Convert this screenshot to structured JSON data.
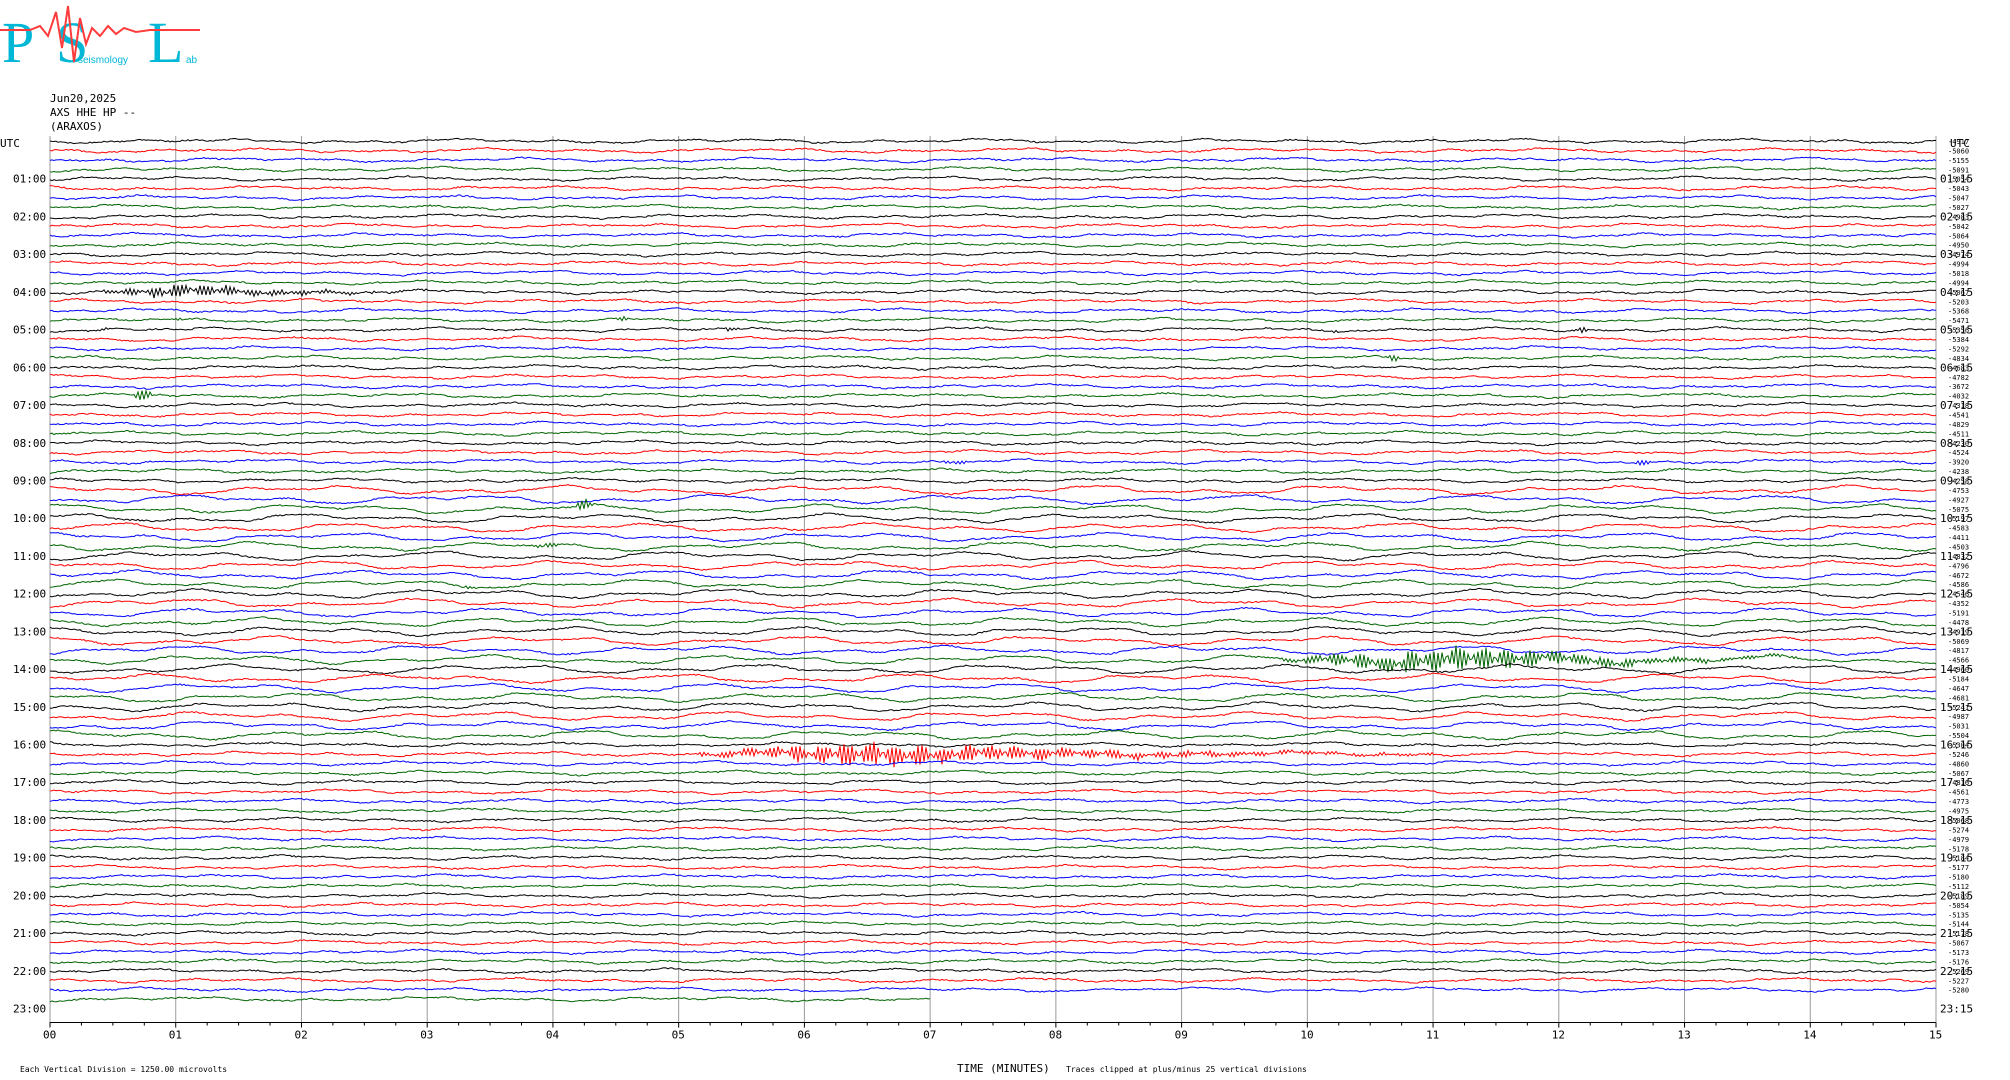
{
  "logo": {
    "letters": [
      "P",
      "S",
      "L"
    ],
    "subtext_1": "seismology",
    "subtext_2": "ab",
    "colors": {
      "letters": "#00b7d6",
      "wave": "#ff3b3b"
    }
  },
  "header": {
    "date": "Jun20,2025",
    "channel": "AXS HHE HP --",
    "station": "(ARAXOS)"
  },
  "chart_data": {
    "type": "line",
    "title": "",
    "xlabel": "TIME (MINUTES)",
    "ylabel_left": "UTC",
    "ylabel_right": "UTC",
    "xlim": [
      0,
      15
    ],
    "x_ticks": [
      "00",
      "01",
      "02",
      "03",
      "04",
      "05",
      "06",
      "07",
      "08",
      "09",
      "10",
      "11",
      "12",
      "13",
      "14",
      "15"
    ],
    "left_hour_labels": [
      "01:00",
      "02:00",
      "03:00",
      "04:00",
      "05:00",
      "06:00",
      "07:00",
      "08:00",
      "09:00",
      "10:00",
      "11:00",
      "12:00",
      "13:00",
      "14:00",
      "15:00",
      "16:00",
      "17:00",
      "18:00",
      "19:00",
      "20:00",
      "21:00",
      "22:00",
      "23:00"
    ],
    "right_hour_labels": [
      "01:15",
      "02:15",
      "03:15",
      "04:15",
      "05:15",
      "06:15",
      "07:15",
      "08:15",
      "09:15",
      "10:15",
      "11:15",
      "12:15",
      "13:15",
      "14:15",
      "15:15",
      "16:15",
      "17:15",
      "18:15",
      "19:15",
      "20:15",
      "21:15",
      "22:15",
      "23:15"
    ],
    "trace_count": 92,
    "traces_per_hour": 4,
    "last_trace_end_minute": 7,
    "trace_colors": [
      "#000000",
      "#ff0000",
      "#0000ff",
      "#006400"
    ],
    "trace_offsets": [
      -4917,
      -5060,
      -5155,
      -5091,
      -5054,
      -5043,
      -5047,
      -5027,
      -4983,
      -5042,
      -5064,
      -4950,
      -4974,
      -4994,
      -5018,
      -4994,
      -5067,
      -5203,
      -5368,
      -5471,
      -5356,
      -5384,
      -5292,
      -4834,
      -4683,
      -4782,
      -3672,
      -4032,
      -4318,
      -4541,
      -4829,
      -4511,
      -4230,
      -4524,
      -3920,
      -4238,
      -4258,
      -4753,
      -4927,
      -5075,
      -5197,
      -4583,
      -4411,
      -4503,
      -4832,
      -4796,
      -4672,
      -4586,
      -4546,
      -4352,
      -5191,
      -4478,
      -4919,
      -5069,
      -4817,
      -4566,
      -4960,
      -5184,
      -4647,
      -4681,
      -5241,
      -4987,
      -5031,
      -5504,
      -5304,
      -5246,
      -4860,
      -5067,
      -4816,
      -4561,
      -4773,
      -4975,
      -5068,
      -5274,
      -4979,
      -5178,
      -5184,
      -5177,
      -5180,
      -5112,
      -5189,
      -5054,
      -5135,
      -5144,
      -5178,
      -5067,
      -5173,
      -5176,
      -5269,
      -5227,
      -5280
    ],
    "events": [
      {
        "trace": 16,
        "start_min": 0.35,
        "end_min": 3.0,
        "peak_min": 1.0,
        "amplitude": 9
      },
      {
        "trace": 19,
        "start_min": 0.9,
        "end_min": 1.05,
        "peak_min": 0.95,
        "amplitude": 4
      },
      {
        "trace": 19,
        "start_min": 4.5,
        "end_min": 4.6,
        "peak_min": 4.55,
        "amplitude": 3
      },
      {
        "trace": 20,
        "start_min": 0.4,
        "end_min": 0.5,
        "peak_min": 0.45,
        "amplitude": 3
      },
      {
        "trace": 20,
        "start_min": 5.35,
        "end_min": 5.5,
        "peak_min": 5.4,
        "amplitude": 3
      },
      {
        "trace": 20,
        "start_min": 10.1,
        "end_min": 10.25,
        "peak_min": 10.2,
        "amplitude": 3
      },
      {
        "trace": 20,
        "start_min": 12.1,
        "end_min": 12.25,
        "peak_min": 12.2,
        "amplitude": 3
      },
      {
        "trace": 23,
        "start_min": 10.6,
        "end_min": 10.8,
        "peak_min": 10.7,
        "amplitude": 4
      },
      {
        "trace": 27,
        "start_min": 0.6,
        "end_min": 0.9,
        "peak_min": 0.75,
        "amplitude": 7
      },
      {
        "trace": 34,
        "start_min": 7.1,
        "end_min": 7.3,
        "peak_min": 7.2,
        "amplitude": 5
      },
      {
        "trace": 34,
        "start_min": 12.55,
        "end_min": 12.75,
        "peak_min": 12.65,
        "amplitude": 5
      },
      {
        "trace": 39,
        "start_min": 4.1,
        "end_min": 4.4,
        "peak_min": 4.25,
        "amplitude": 7
      },
      {
        "trace": 43,
        "start_min": 3.8,
        "end_min": 4.1,
        "peak_min": 3.95,
        "amplitude": 6
      },
      {
        "trace": 47,
        "start_min": 3.2,
        "end_min": 3.5,
        "peak_min": 3.3,
        "amplitude": 3
      },
      {
        "trace": 55,
        "start_min": 9.6,
        "end_min": 13.9,
        "peak_min": 11.2,
        "amplitude": 16
      },
      {
        "trace": 65,
        "start_min": 5.0,
        "end_min": 11.0,
        "peak_min": 6.5,
        "amplitude": 14
      }
    ],
    "legend": "none",
    "grid": "vertical lines at each minute"
  },
  "footer": {
    "vertical_division_note": "Each Vertical Division = 1250.00 microvolts",
    "clip_note": "Traces clipped at plus/minus 25 vertical divisions"
  }
}
